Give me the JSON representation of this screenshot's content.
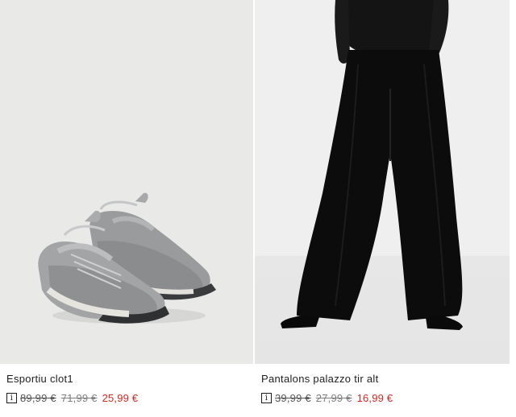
{
  "products": [
    {
      "name": "Esportiu clot1",
      "image": "grey-running-sneakers",
      "info_icon": "info-icon",
      "info_glyph": "i",
      "price_original": "89,99 €",
      "price_previous": "71,99 €",
      "price_current": "25,99 €"
    },
    {
      "name": "Pantalons palazzo tir alt",
      "image": "black-wide-leg-palazzo-trousers",
      "info_icon": "info-icon",
      "info_glyph": "i",
      "price_original": "39,99 €",
      "price_previous": "27,99 €",
      "price_current": "16,99 €"
    }
  ],
  "colors": {
    "sale_price": "#d9261c",
    "text": "#1d1d1d"
  }
}
